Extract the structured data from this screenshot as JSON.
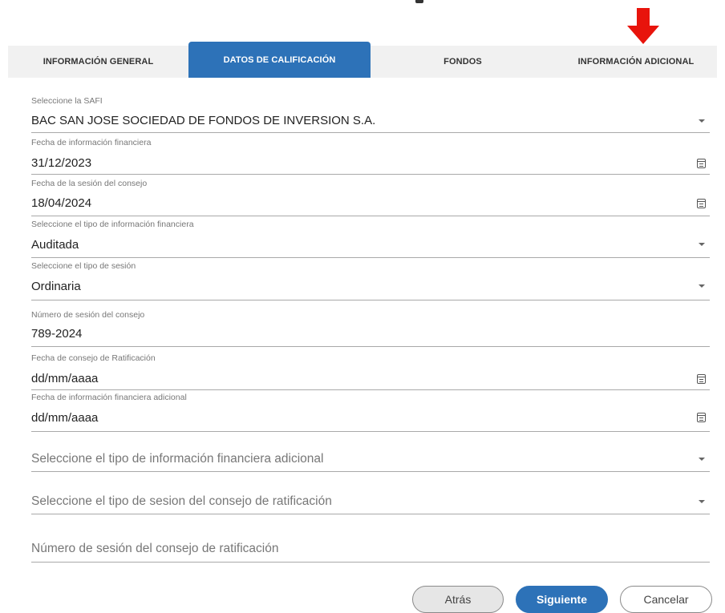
{
  "tabs": [
    {
      "label": "INFORMACIÓN GENERAL"
    },
    {
      "label": "DATOS DE CALIFICACIÓN"
    },
    {
      "label": "FONDOS"
    },
    {
      "label": "INFORMACIÓN ADICIONAL"
    }
  ],
  "active_tab": "DATOS DE CALIFICACIÓN",
  "form": {
    "safi": {
      "label": "Seleccione la SAFI",
      "value": "BAC SAN JOSE SOCIEDAD DE FONDOS DE INVERSION S.A."
    },
    "fecha_info_financiera": {
      "label": "Fecha de información financiera",
      "value": "31/12/2023"
    },
    "fecha_sesion_consejo": {
      "label": "Fecha de la sesión del consejo",
      "value": "18/04/2024"
    },
    "tipo_info_financiera": {
      "label": "Seleccione el tipo de información financiera",
      "value": "Auditada"
    },
    "tipo_sesion": {
      "label": "Seleccione el tipo de sesión",
      "value": "Ordinaria"
    },
    "numero_sesion": {
      "label": "Número de sesión del consejo",
      "value": "789-2024"
    },
    "fecha_ratificacion": {
      "label": "Fecha de consejo de Ratificación",
      "value": "dd/mm/aaaa"
    },
    "fecha_info_adicional": {
      "label": "Fecha de información financiera adicional",
      "value": "dd/mm/aaaa"
    },
    "tipo_info_adicional": {
      "placeholder": "Seleccione el tipo de información financiera adicional"
    },
    "tipo_sesion_ratificacion": {
      "placeholder": "Seleccione el tipo de sesion del consejo de ratificación"
    },
    "numero_sesion_ratificacion": {
      "placeholder": "Número de sesión del consejo de ratificación"
    }
  },
  "buttons": {
    "back": "Atrás",
    "next": "Siguiente",
    "cancel": "Cancelar"
  },
  "colors": {
    "accent": "#2d72b8",
    "arrow": "#e8140c",
    "tab_bar": "#f1f1f1",
    "underline": "#a9a9a9"
  }
}
